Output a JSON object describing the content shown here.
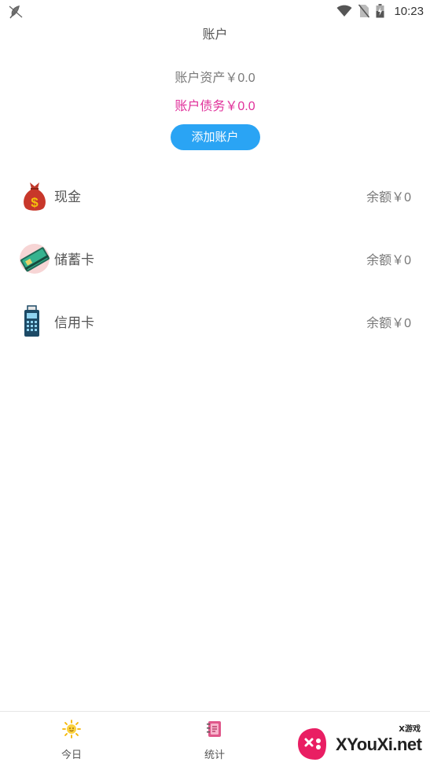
{
  "status_bar": {
    "time": "10:23",
    "left_icon": "feather-notification-icon",
    "icons": [
      "wifi-icon",
      "no-sim-icon",
      "battery-charging-icon"
    ]
  },
  "header": {
    "title": "账户"
  },
  "summary": {
    "assets_label": "账户资产",
    "assets_value": "￥0.0",
    "debt_label": "账户债务",
    "debt_value": "￥0.0",
    "debt_color": "#e0309a",
    "add_button_label": "添加账户",
    "accent_color": "#2aa4f4"
  },
  "accounts": [
    {
      "name": "现金",
      "icon": "money-bag-icon",
      "balance_label": "余额",
      "balance_value": "￥0"
    },
    {
      "name": "储蓄卡",
      "icon": "bank-card-icon",
      "balance_label": "余额",
      "balance_value": "￥0"
    },
    {
      "name": "信用卡",
      "icon": "pos-terminal-icon",
      "balance_label": "余额",
      "balance_value": "￥0"
    }
  ],
  "bottom_nav": {
    "items": [
      {
        "label": "今日",
        "icon": "sun-icon"
      },
      {
        "label": "统计",
        "icon": "notebook-icon"
      }
    ]
  },
  "watermark": {
    "brand": "XYouXi.net",
    "tag": "X游戏"
  }
}
